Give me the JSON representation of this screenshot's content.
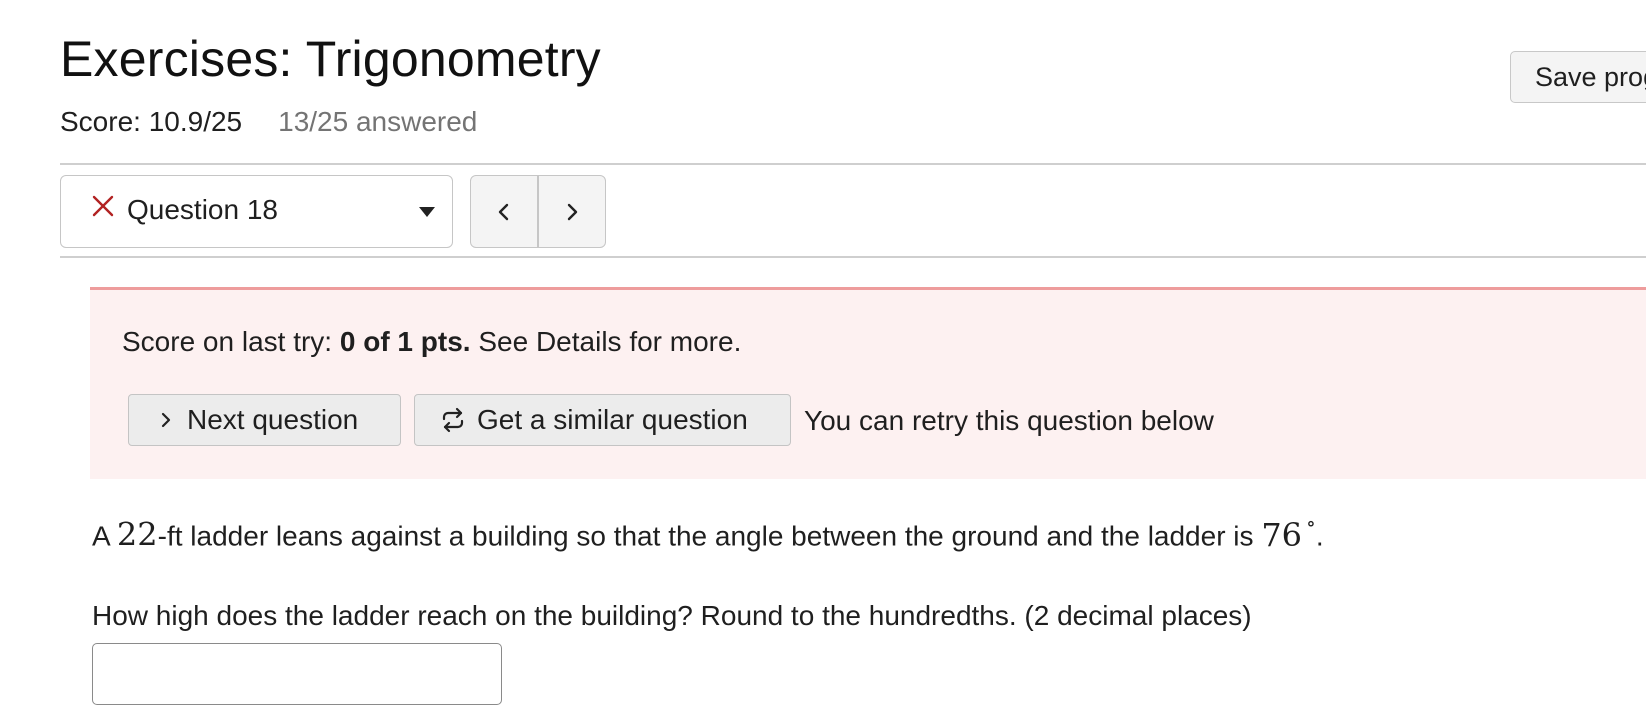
{
  "header": {
    "title": "Exercises: Trigonometry",
    "save_label": "Save progress",
    "score": "Score: 10.9/25",
    "answered": "13/25 answered"
  },
  "question_nav": {
    "status_icon": "x-mark-icon",
    "status_color": "#b22222",
    "selected_question": "Question 18",
    "caret_icon": "caret-down-icon",
    "prev_icon": "chevron-left-icon",
    "next_icon": "chevron-right-icon"
  },
  "feedback": {
    "prefix": "Score on last try: ",
    "points": "0 of 1 pts.",
    "suffix": " See Details for more.",
    "next_question_label": "Next question",
    "similar_question_label": "Get a similar question",
    "retry_note": "You can retry this question below",
    "border_color": "#ee9c9c",
    "background_color": "#fdf1f1"
  },
  "question": {
    "text_a": "A ",
    "ladder_length": "22",
    "text_b": "-ft ladder leans against a building so that the angle between the ground and the ladder is ",
    "angle": "76",
    "degree_symbol": "∘",
    "text_c": ".",
    "prompt": "How high does the ladder reach on the building? Round to the hundredths. (2 decimal places)",
    "answer_value": ""
  }
}
